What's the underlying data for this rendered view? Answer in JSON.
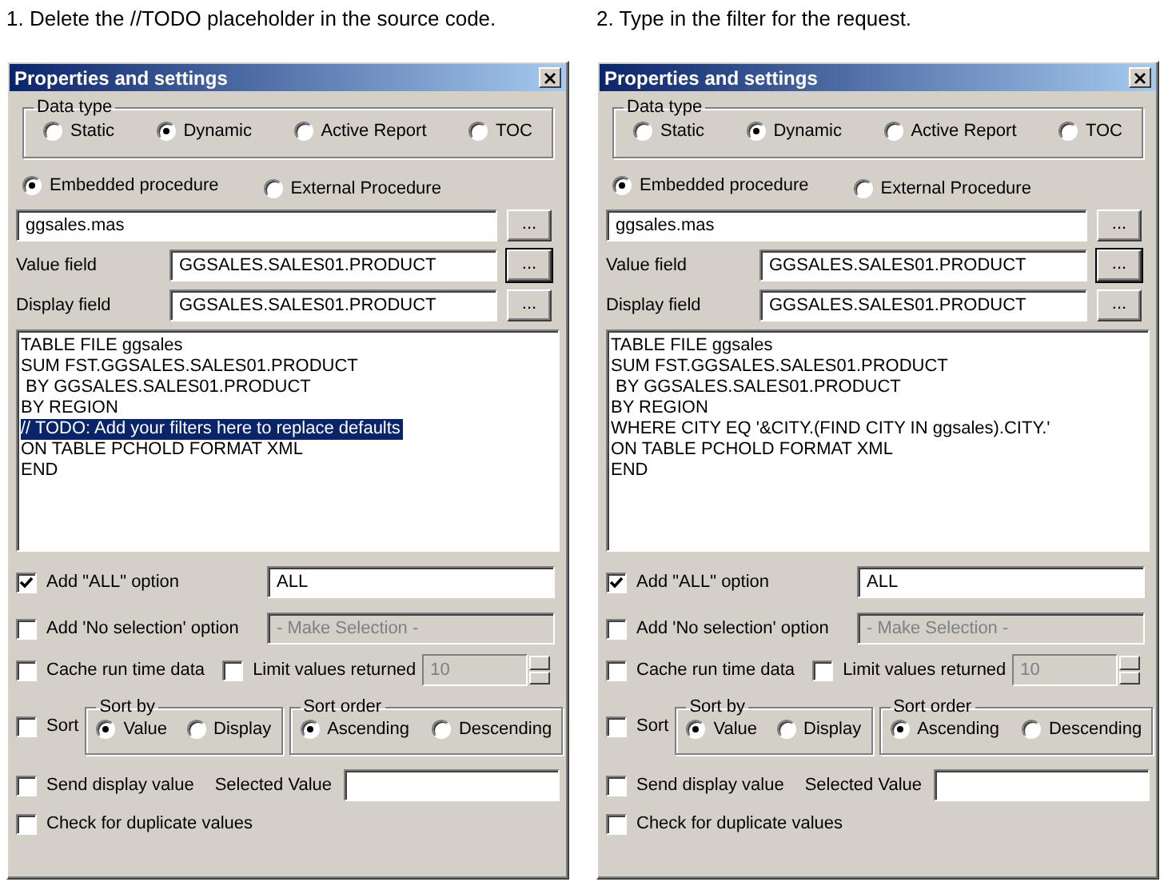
{
  "panels": [
    {
      "caption": "1. Delete the //TODO placeholder in the source code.",
      "window_title": "Properties and settings",
      "data_type": {
        "label": "Data type",
        "options": [
          {
            "label": "Static",
            "selected": false
          },
          {
            "label": "Dynamic",
            "selected": true
          },
          {
            "label": "Active Report",
            "selected": false
          },
          {
            "label": "TOC",
            "selected": false
          }
        ]
      },
      "procedure_options": [
        {
          "label": "Embedded procedure",
          "selected": true
        },
        {
          "label": "External Procedure",
          "selected": false
        }
      ],
      "master_file": {
        "value": "ggsales.mas",
        "browse": "..."
      },
      "value_field": {
        "label": "Value field",
        "value": "GGSALES.SALES01.PRODUCT",
        "browse": "..."
      },
      "display_field": {
        "label": "Display field",
        "value": "GGSALES.SALES01.PRODUCT",
        "browse": "..."
      },
      "code_lines": [
        {
          "text": "TABLE FILE ggsales",
          "selected": false
        },
        {
          "text": "SUM FST.GGSALES.SALES01.PRODUCT",
          "selected": false
        },
        {
          "text": " BY GGSALES.SALES01.PRODUCT",
          "selected": false
        },
        {
          "text": "BY REGION",
          "selected": false
        },
        {
          "text": "// TODO: Add your filters here to replace defaults",
          "selected": true
        },
        {
          "text": "ON TABLE PCHOLD FORMAT XML",
          "selected": false
        },
        {
          "text": "END",
          "selected": false
        }
      ],
      "add_all": {
        "label": "Add \"ALL\" option",
        "checked": true,
        "value": "ALL"
      },
      "add_no_selection": {
        "label": "Add 'No selection' option",
        "checked": false,
        "value": "- Make Selection -",
        "field_disabled": true
      },
      "cache": {
        "label": "Cache run time data",
        "checked": false
      },
      "limit": {
        "label": "Limit values returned",
        "checked": false,
        "value": "10",
        "field_disabled": true
      },
      "sort": {
        "label": "Sort",
        "checked": false,
        "sort_by": {
          "label": "Sort by",
          "options": [
            {
              "label": "Value",
              "selected": true
            },
            {
              "label": "Display",
              "selected": false
            }
          ]
        },
        "sort_order": {
          "label": "Sort order",
          "options": [
            {
              "label": "Ascending",
              "selected": true
            },
            {
              "label": "Descending",
              "selected": false
            }
          ]
        }
      },
      "send_display": {
        "label": "Send display value",
        "checked": false
      },
      "selected_value": {
        "label": "Selected Value"
      },
      "check_duplicates": {
        "label": "Check for duplicate values",
        "checked": false
      }
    },
    {
      "caption": "2. Type in the filter for the request.",
      "window_title": "Properties and settings",
      "data_type": {
        "label": "Data type",
        "options": [
          {
            "label": "Static",
            "selected": false
          },
          {
            "label": "Dynamic",
            "selected": true
          },
          {
            "label": "Active Report",
            "selected": false
          },
          {
            "label": "TOC",
            "selected": false
          }
        ]
      },
      "procedure_options": [
        {
          "label": "Embedded procedure",
          "selected": true
        },
        {
          "label": "External Procedure",
          "selected": false
        }
      ],
      "master_file": {
        "value": "ggsales.mas",
        "browse": "..."
      },
      "value_field": {
        "label": "Value field",
        "value": "GGSALES.SALES01.PRODUCT",
        "browse": "..."
      },
      "display_field": {
        "label": "Display field",
        "value": "GGSALES.SALES01.PRODUCT",
        "browse": "..."
      },
      "code_lines": [
        {
          "text": "TABLE FILE ggsales",
          "selected": false
        },
        {
          "text": "SUM FST.GGSALES.SALES01.PRODUCT",
          "selected": false
        },
        {
          "text": " BY GGSALES.SALES01.PRODUCT",
          "selected": false
        },
        {
          "text": "BY REGION",
          "selected": false
        },
        {
          "text": "WHERE CITY EQ '&CITY.(FIND CITY IN ggsales).CITY.'",
          "selected": false
        },
        {
          "text": "ON TABLE PCHOLD FORMAT XML",
          "selected": false
        },
        {
          "text": "END",
          "selected": false
        }
      ],
      "add_all": {
        "label": "Add \"ALL\" option",
        "checked": true,
        "value": "ALL"
      },
      "add_no_selection": {
        "label": "Add 'No selection' option",
        "checked": false,
        "value": "- Make Selection -",
        "field_disabled": true
      },
      "cache": {
        "label": "Cache run time data",
        "checked": false
      },
      "limit": {
        "label": "Limit values returned",
        "checked": false,
        "value": "10",
        "field_disabled": true
      },
      "sort": {
        "label": "Sort",
        "checked": false,
        "sort_by": {
          "label": "Sort by",
          "options": [
            {
              "label": "Value",
              "selected": true
            },
            {
              "label": "Display",
              "selected": false
            }
          ]
        },
        "sort_order": {
          "label": "Sort order",
          "options": [
            {
              "label": "Ascending",
              "selected": true
            },
            {
              "label": "Descending",
              "selected": false
            }
          ]
        }
      },
      "send_display": {
        "label": "Send display value",
        "checked": false
      },
      "selected_value": {
        "label": "Selected Value"
      },
      "check_duplicates": {
        "label": "Check for duplicate values",
        "checked": false
      }
    }
  ]
}
